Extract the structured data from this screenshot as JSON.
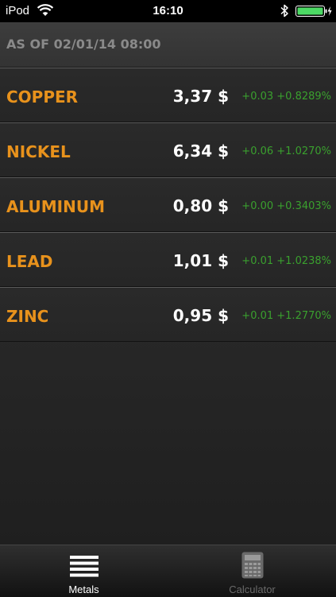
{
  "status_bar": {
    "carrier": "iPod",
    "time": "16:10"
  },
  "header": {
    "as_of": "AS OF 02/01/14 08:00"
  },
  "metals": [
    {
      "name": "COPPER",
      "price": "3,37 $",
      "change": "+0.03 +0.8289%"
    },
    {
      "name": "NICKEL",
      "price": "6,34 $",
      "change": "+0.06 +1.0270%"
    },
    {
      "name": "ALUMINUM",
      "price": "0,80 $",
      "change": "+0.00 +0.3403%"
    },
    {
      "name": "LEAD",
      "price": "1,01 $",
      "change": "+0.01 +1.0238%"
    },
    {
      "name": "ZINC",
      "price": "0,95 $",
      "change": "+0.01 +1.2770%"
    }
  ],
  "tabs": [
    {
      "label": "Metals",
      "icon": "list-icon",
      "selected": true
    },
    {
      "label": "Calculator",
      "icon": "calculator-icon",
      "selected": false
    }
  ],
  "colors": {
    "metal_name": "#e8921c",
    "price": "#ffffff",
    "change_positive": "#3aa02e",
    "as_of_text": "#8a8a8a",
    "battery": "#4cd964"
  }
}
